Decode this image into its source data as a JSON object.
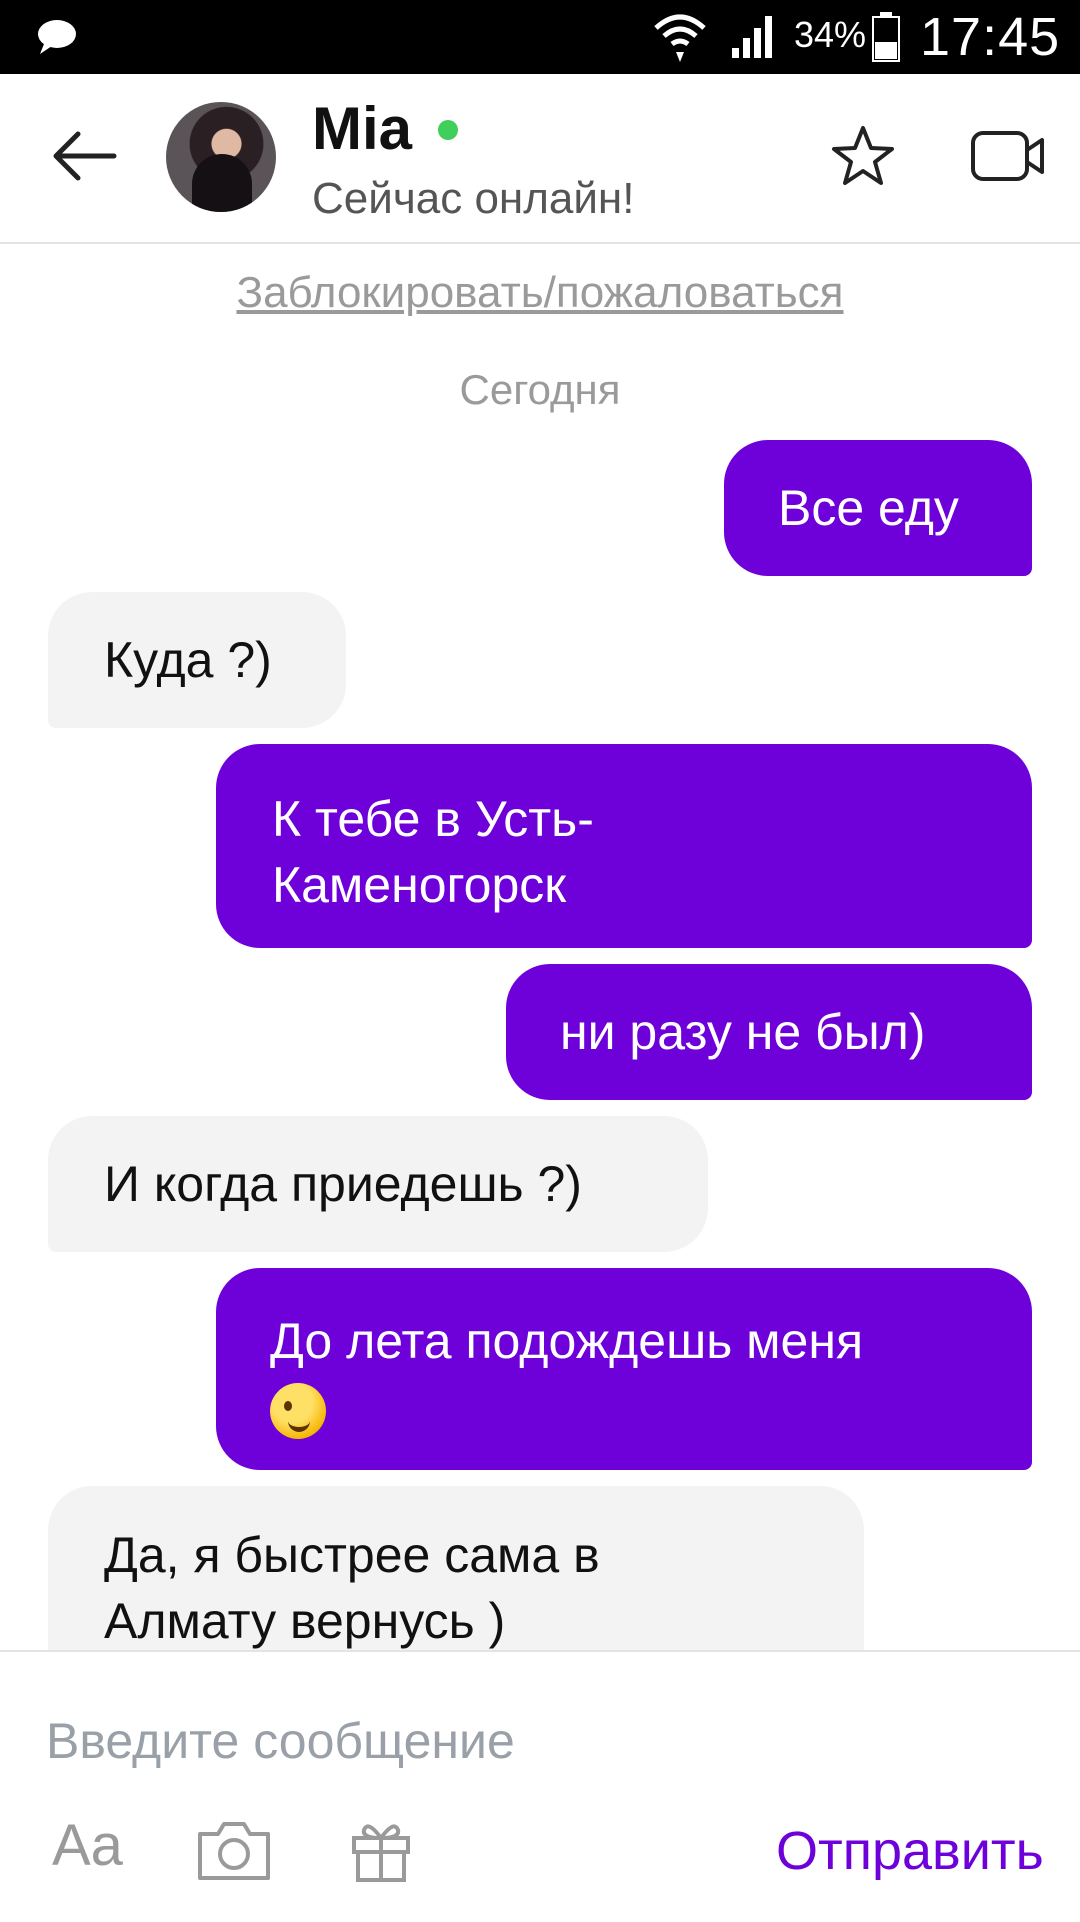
{
  "status_bar": {
    "battery_percent": "34%",
    "time": "17:45",
    "icons": [
      "message-icon",
      "wifi-icon",
      "signal-icon",
      "battery-icon"
    ]
  },
  "header": {
    "contact_name": "Mia",
    "status": "Сейчас онлайн!",
    "online": true,
    "icons": [
      "back-arrow-icon",
      "star-icon",
      "video-camera-icon"
    ]
  },
  "block_link": "Заблокировать/пожаловаться",
  "date_label": "Сегодня",
  "messages": [
    {
      "direction": "outgoing",
      "lines": [
        "Все еду"
      ]
    },
    {
      "direction": "incoming",
      "lines": [
        "Куда ?)"
      ]
    },
    {
      "direction": "outgoing",
      "lines": [
        "К тебе в Усть-",
        "Каменогорск"
      ]
    },
    {
      "direction": "outgoing",
      "lines": [
        "ни разу не был)"
      ]
    },
    {
      "direction": "incoming",
      "lines": [
        "И когда приедешь ?)"
      ]
    },
    {
      "direction": "outgoing",
      "lines": [
        "До лета подождешь меня"
      ],
      "emoji": "winking-face-emoji"
    },
    {
      "direction": "incoming",
      "lines": [
        "Да, я быстрее сама в",
        "Алмату вернусь )"
      ]
    }
  ],
  "composer": {
    "placeholder": "Введите сообщение",
    "value": "",
    "format_label": "Aa",
    "send_label": "Отправить",
    "icons": [
      "camera-icon",
      "gift-icon"
    ]
  },
  "colors": {
    "accent": "#6e00d9",
    "incoming_bubble": "#f3f3f3",
    "online_dot": "#3fcf5a"
  }
}
